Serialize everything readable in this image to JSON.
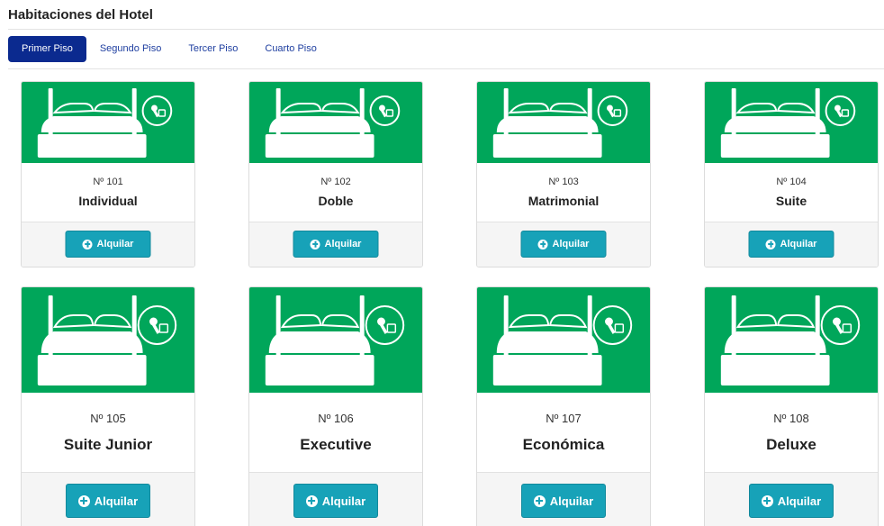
{
  "page": {
    "title": "Habitaciones del Hotel"
  },
  "tabs": [
    {
      "label": "Primer Piso",
      "active": true
    },
    {
      "label": "Segundo Piso",
      "active": false
    },
    {
      "label": "Tercer Piso",
      "active": false
    },
    {
      "label": "Cuarto Piso",
      "active": false
    }
  ],
  "colors": {
    "card_image_bg": "#00a65a",
    "button_bg": "#17a2b8",
    "active_tab_bg": "#0b2a8f"
  },
  "rooms": [
    {
      "number": "Nº 101",
      "type": "Individual",
      "button_label": "Alquilar",
      "icon": "bed-icon"
    },
    {
      "number": "Nº 102",
      "type": "Doble",
      "button_label": "Alquilar",
      "icon": "bed-icon"
    },
    {
      "number": "Nº 103",
      "type": "Matrimonial",
      "button_label": "Alquilar",
      "icon": "bed-icon"
    },
    {
      "number": "Nº 104",
      "type": "Suite",
      "button_label": "Alquilar",
      "icon": "bed-icon"
    },
    {
      "number": "Nº 105",
      "type": "Suite Junior",
      "button_label": "Alquilar",
      "icon": "bed-icon"
    },
    {
      "number": "Nº 106",
      "type": "Executive",
      "button_label": "Alquilar",
      "icon": "bed-icon"
    },
    {
      "number": "Nº 107",
      "type": "Económica",
      "button_label": "Alquilar",
      "icon": "bed-icon"
    },
    {
      "number": "Nº 108",
      "type": "Deluxe",
      "button_label": "Alquilar",
      "icon": "bed-icon"
    }
  ]
}
